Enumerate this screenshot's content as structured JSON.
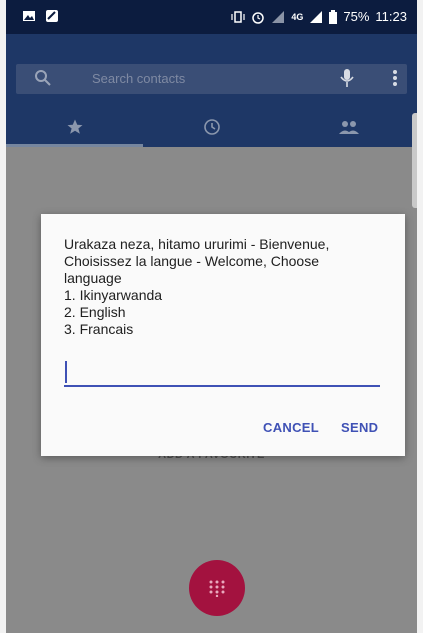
{
  "status_bar": {
    "battery": "75%",
    "time": "11:23",
    "network": "4G"
  },
  "search": {
    "placeholder": "Search contacts"
  },
  "tabs": [
    {
      "name": "favorites",
      "icon": "star-icon"
    },
    {
      "name": "recents",
      "icon": "clock-icon"
    },
    {
      "name": "contacts",
      "icon": "people-icon"
    }
  ],
  "background": {
    "add_favorite": "ADD A FAVOURITE"
  },
  "dialog": {
    "lines": [
      "Urakaza neza, hitamo ururimi - Bienvenue,",
      "Choisissez la langue - Welcome, Choose",
      "language",
      "1. Ikinyarwanda",
      "2. English",
      "3. Francais"
    ],
    "input_value": "",
    "cancel_label": "CANCEL",
    "send_label": "SEND"
  },
  "colors": {
    "accent": "#3f51b5",
    "appbar": "#1e3766",
    "fab": "#a3123f"
  }
}
